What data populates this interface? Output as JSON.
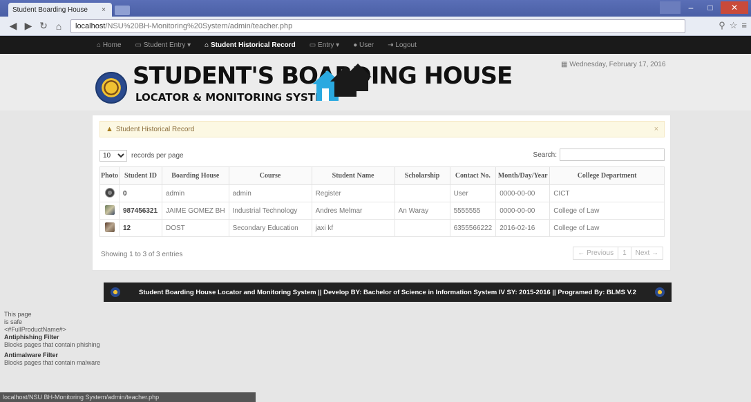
{
  "browser": {
    "tab_title": "Student Boarding House",
    "tab_close": "×",
    "window_buttons": [
      "",
      "‒",
      "□",
      "✕"
    ],
    "nav": {
      "back": "◀",
      "forward": "▶",
      "reload": "↻",
      "home": "⌂"
    },
    "url_host": "localhost",
    "url_path": "/NSU%20BH-Monitoring%20System/admin/teacher.php",
    "right_icons": [
      "⚲",
      "☆",
      "≡"
    ]
  },
  "site_nav": {
    "items": [
      {
        "label": "Home",
        "icon": "home-icon"
      },
      {
        "label": "Student Entry",
        "icon": "list-icon"
      },
      {
        "label": "Student Historical Record",
        "icon": "home-icon",
        "active": true
      },
      {
        "label": "Entry",
        "icon": "list-icon"
      },
      {
        "label": "User",
        "icon": "user-icon"
      },
      {
        "label": "Logout",
        "icon": "logout-icon"
      }
    ]
  },
  "header": {
    "title": "STUDENT'S BOARDING HOUSE",
    "subtitle": "LOCATOR & MONITORING SYSTEM",
    "date": "Wednesday, February 17, 2016"
  },
  "panel": {
    "alert_title": "Student Historical Record",
    "alert_close": "×",
    "page_size": "10",
    "page_size_label": "records per page",
    "search_label": "Search:",
    "search_value": "",
    "columns": [
      "Photo",
      "Student ID",
      "Boarding House",
      "Course",
      "Student Name",
      "Scholarship",
      "Contact No.",
      "Month/Day/Year",
      "College Department"
    ],
    "rows": [
      {
        "photo": "seal",
        "id": "0",
        "boarding_house": "admin",
        "course": "admin",
        "name": "Register",
        "scholarship": "",
        "contact": "User",
        "date": "0000-00-00",
        "department": "CICT"
      },
      {
        "photo": "img1",
        "id": "987456321",
        "boarding_house": "JAIME GOMEZ BH",
        "course": "Industrial Technology",
        "name": "Andres Melmar",
        "scholarship": "An Waray",
        "contact": "5555555",
        "date": "0000-00-00",
        "department": "College of Law"
      },
      {
        "photo": "img2",
        "id": "12",
        "boarding_house": "DOST",
        "course": "Secondary Education",
        "name": "jaxi kf",
        "scholarship": "",
        "contact": "6355566222",
        "date": "2016-02-16",
        "department": "College of Law"
      }
    ],
    "info": "Showing 1 to 3 of 3 entries",
    "pager": {
      "prev": "← Previous",
      "page": "1",
      "next": "Next →"
    }
  },
  "footer": {
    "text": "Student Boarding House Locator and Monitoring System  ||  Develop BY: Bachelor of Science in Information System IV SY: 2015-2016  ||  Programed By: BLMS V.2"
  },
  "side_overlay": {
    "line1": "This page",
    "line2": "is safe",
    "line3": "<#FullProductName#>",
    "anti_phishing_title": "Antiphishing Filter",
    "anti_phishing_desc": "Blocks pages that contain phishing",
    "anti_malware_title": "Antimalware Filter",
    "anti_malware_desc": "Blocks pages that contain malware"
  },
  "status_bar": "localhost/NSU BH-Monitoring System/admin/teacher.php"
}
